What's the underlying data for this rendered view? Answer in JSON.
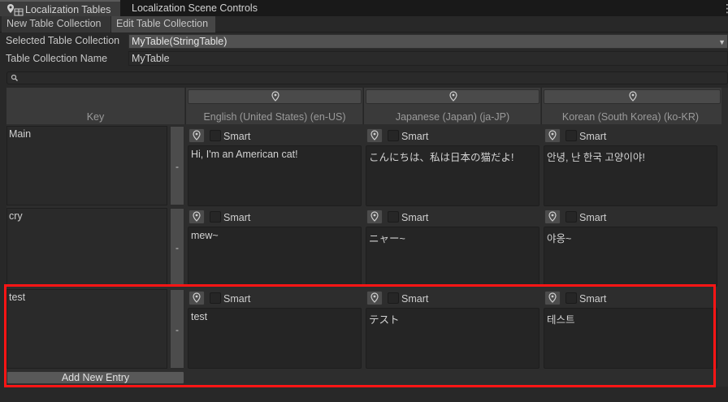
{
  "window": {
    "tabs": [
      {
        "label": "Localization Tables",
        "active": true
      },
      {
        "label": "Localization Scene Controls",
        "active": false
      }
    ]
  },
  "toolbar": {
    "new_label": "New Table Collection",
    "edit_label": "Edit Table Collection"
  },
  "form": {
    "selected_label": "Selected Table Collection",
    "selected_value": "MyTable(StringTable)",
    "name_label": "Table Collection Name",
    "name_value": "MyTable"
  },
  "search": {
    "placeholder": ""
  },
  "table": {
    "key_header": "Key",
    "columns": [
      {
        "label": "English (United States) (en-US)"
      },
      {
        "label": "Japanese (Japan) (ja-JP)"
      },
      {
        "label": "Korean (South Korea) (ko-KR)"
      }
    ],
    "smart_label": "Smart",
    "remove_label": "-",
    "rows": [
      {
        "key": "Main",
        "values": [
          "Hi, I'm an American cat!",
          "こんにちは、私は日本の猫だよ!",
          "안녕, 난 한국 고양이야!"
        ]
      },
      {
        "key": "cry",
        "values": [
          "mew~",
          "ニャー~",
          "야옹~"
        ]
      },
      {
        "key": "test",
        "values": [
          "test",
          "テスト",
          "테스트"
        ]
      }
    ],
    "add_entry_label": "Add New Entry"
  },
  "colors": {
    "highlight": "#ff1515",
    "background": "#282828"
  }
}
